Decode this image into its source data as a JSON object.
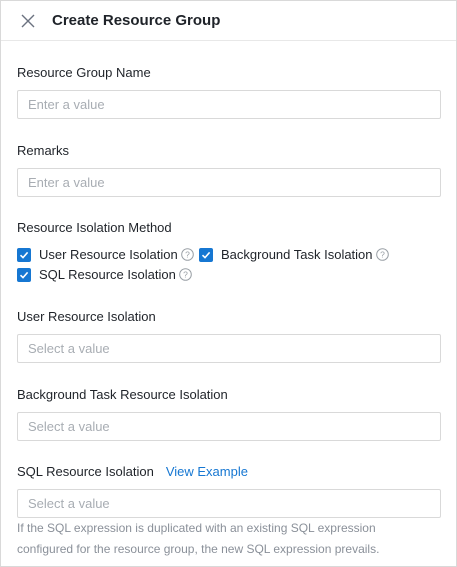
{
  "dialog": {
    "title": "Create Resource Group",
    "close_icon": "close-icon"
  },
  "fields": {
    "group_name": {
      "label": "Resource Group Name",
      "placeholder": "Enter a value",
      "value": ""
    },
    "remarks": {
      "label": "Remarks",
      "placeholder": "Enter a value",
      "value": ""
    },
    "isolation_method": {
      "label": "Resource Isolation Method",
      "options": [
        {
          "label": "User Resource Isolation",
          "checked": true,
          "help_icon": "help-circle-icon"
        },
        {
          "label": "Background Task Isolation",
          "checked": true,
          "help_icon": "help-circle-icon"
        },
        {
          "label": "SQL Resource Isolation",
          "checked": true,
          "help_icon": "help-circle-icon"
        }
      ]
    },
    "user_isolation": {
      "label": "User Resource Isolation",
      "placeholder": "Select a value"
    },
    "bg_task_isolation": {
      "label": "Background Task Resource Isolation",
      "placeholder": "Select a value"
    },
    "sql_isolation": {
      "label": "SQL Resource Isolation",
      "link": "View Example",
      "placeholder": "Select a value",
      "hint_line1": "If the SQL expression is duplicated with an existing SQL expression",
      "hint_line2": "configured for the resource group, the new SQL expression prevails."
    }
  },
  "colors": {
    "accent": "#1677d2",
    "border": "#d9d9d9",
    "placeholder": "#a8adb3",
    "hint": "#8a9099"
  }
}
